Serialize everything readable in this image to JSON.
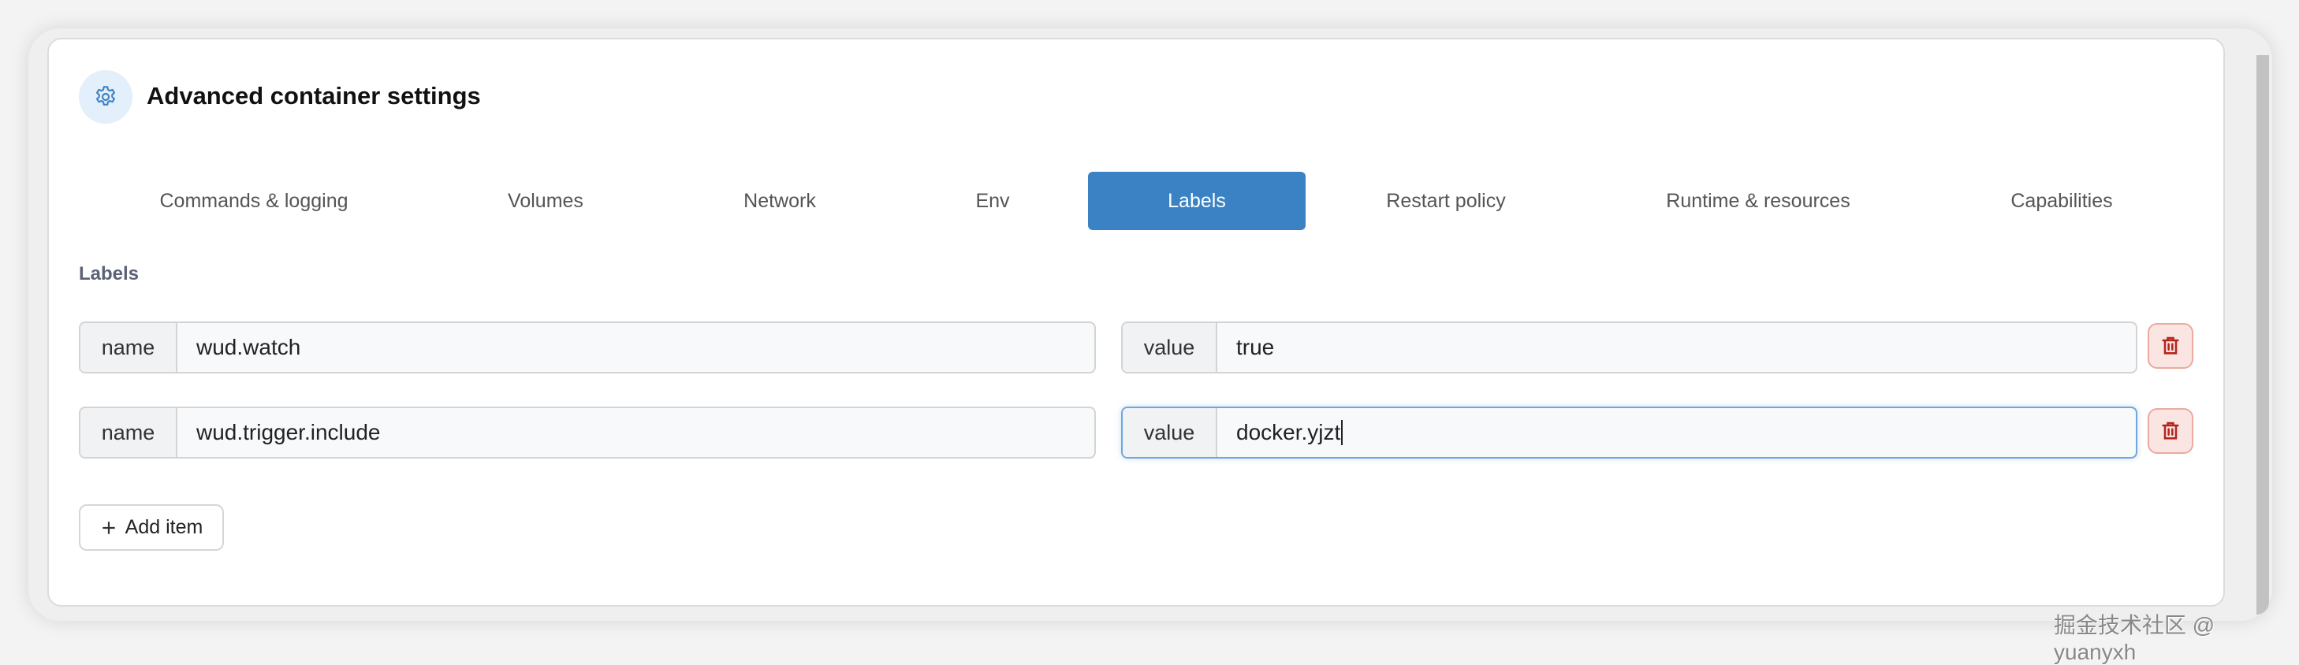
{
  "header": {
    "title": "Advanced container settings"
  },
  "tabs": [
    {
      "label": "Commands & logging"
    },
    {
      "label": "Volumes"
    },
    {
      "label": "Network"
    },
    {
      "label": "Env"
    },
    {
      "label": "Labels",
      "active": true
    },
    {
      "label": "Restart policy"
    },
    {
      "label": "Runtime & resources"
    },
    {
      "label": "Capabilities"
    }
  ],
  "section": {
    "title": "Labels"
  },
  "labels": [
    {
      "name_addon": "name",
      "name": "wud.watch",
      "value_addon": "value",
      "value": "true"
    },
    {
      "name_addon": "name",
      "name": "wud.trigger.include",
      "value_addon": "value",
      "value": "docker.yjzt"
    }
  ],
  "add_item_label": "Add item",
  "watermark": "掘金技术社区 @ yuanyxh",
  "colors": {
    "accent": "#3b82c4",
    "danger": "#b3261e"
  }
}
